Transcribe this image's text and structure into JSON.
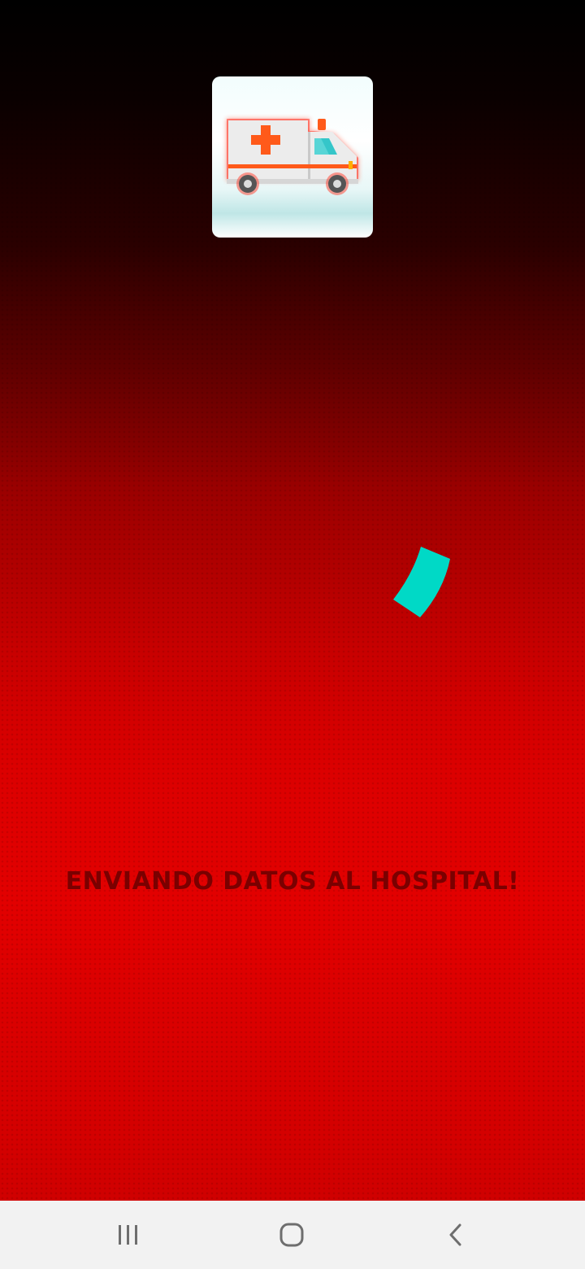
{
  "app": {
    "logo_icon": "ambulance-icon",
    "status_message": "ENVIANDO DATOS AL HOSPITAL!",
    "spinner_icon": "loading-spinner-icon",
    "colors": {
      "background_top": "#000000",
      "background_bottom": "#e00000",
      "status_text": "#7a0000",
      "spinner": "#00d9c6"
    }
  },
  "navigation_bar": {
    "recent_apps_icon": "recent-apps-icon",
    "home_icon": "home-icon",
    "back_icon": "back-icon"
  }
}
